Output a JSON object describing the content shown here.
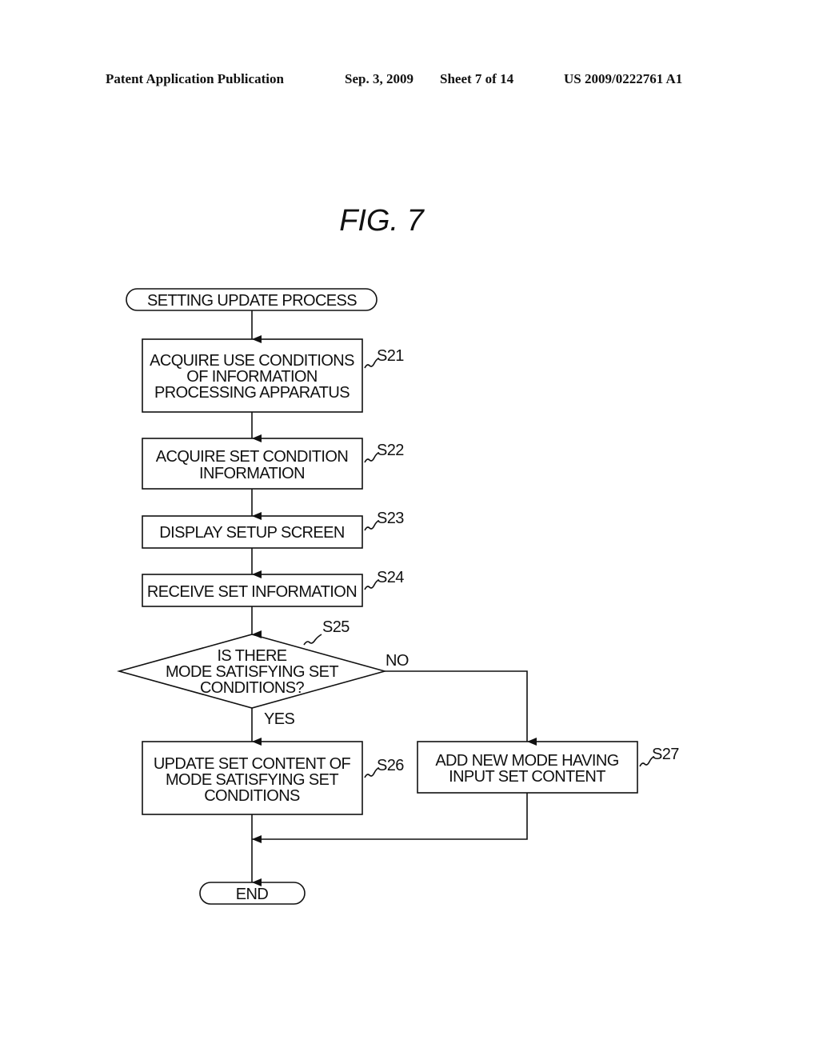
{
  "header": {
    "publication": "Patent Application Publication",
    "date": "Sep. 3, 2009",
    "sheet": "Sheet 7 of 14",
    "number": "US 2009/0222761 A1"
  },
  "figure_title": "FIG. 7",
  "flowchart": {
    "start": "SETTING UPDATE PROCESS",
    "steps": [
      {
        "id": "S21",
        "lines": [
          "ACQUIRE USE CONDITIONS",
          "OF INFORMATION",
          "PROCESSING APPARATUS"
        ]
      },
      {
        "id": "S22",
        "lines": [
          "ACQUIRE SET CONDITION",
          "INFORMATION"
        ]
      },
      {
        "id": "S23",
        "lines": [
          "DISPLAY SETUP SCREEN"
        ]
      },
      {
        "id": "S24",
        "lines": [
          "RECEIVE SET INFORMATION"
        ]
      }
    ],
    "decision": {
      "id": "S25",
      "lines": [
        "IS THERE",
        "MODE SATISFYING SET",
        "CONDITIONS?"
      ],
      "yes": "YES",
      "no": "NO"
    },
    "yes_step": {
      "id": "S26",
      "lines": [
        "UPDATE SET CONTENT OF",
        "MODE SATISFYING SET",
        "CONDITIONS"
      ]
    },
    "no_step": {
      "id": "S27",
      "lines": [
        "ADD NEW MODE HAVING",
        "INPUT SET CONTENT"
      ]
    },
    "end": "END"
  }
}
